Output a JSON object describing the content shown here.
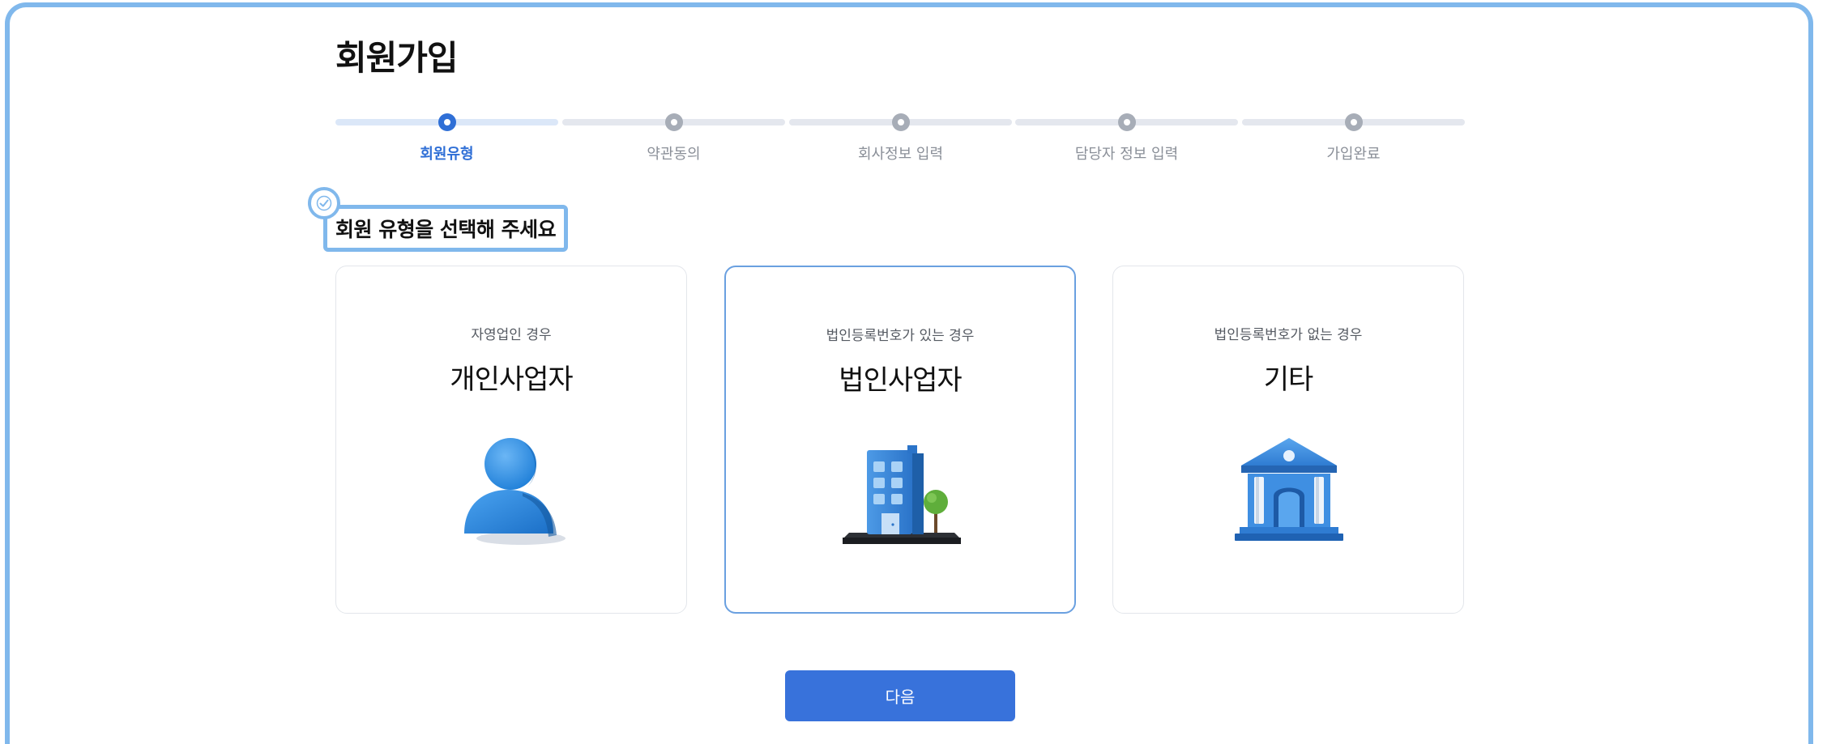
{
  "page": {
    "title": "회원가입"
  },
  "stepper": {
    "active_index": 0,
    "steps": [
      {
        "label": "회원유형"
      },
      {
        "label": "약관동의"
      },
      {
        "label": "회사정보 입력"
      },
      {
        "label": "담당자 정보 입력"
      },
      {
        "label": "가입완료"
      }
    ]
  },
  "section": {
    "heading": "회원 유형을 선택해 주세요"
  },
  "cards": [
    {
      "sub": "자영업인 경우",
      "title": "개인사업자",
      "icon": "person-icon",
      "selected": false
    },
    {
      "sub": "법인등록번호가 있는 경우",
      "title": "법인사업자",
      "icon": "office-building-icon",
      "selected": true
    },
    {
      "sub": "법인등록번호가 없는 경우",
      "title": "기타",
      "icon": "institution-building-icon",
      "selected": false
    }
  ],
  "actions": {
    "next_label": "다음"
  },
  "colors": {
    "accent": "#2f6fd6",
    "button": "#3872db",
    "frame": "#80b8ec",
    "selected_border": "#6aa0e0"
  }
}
